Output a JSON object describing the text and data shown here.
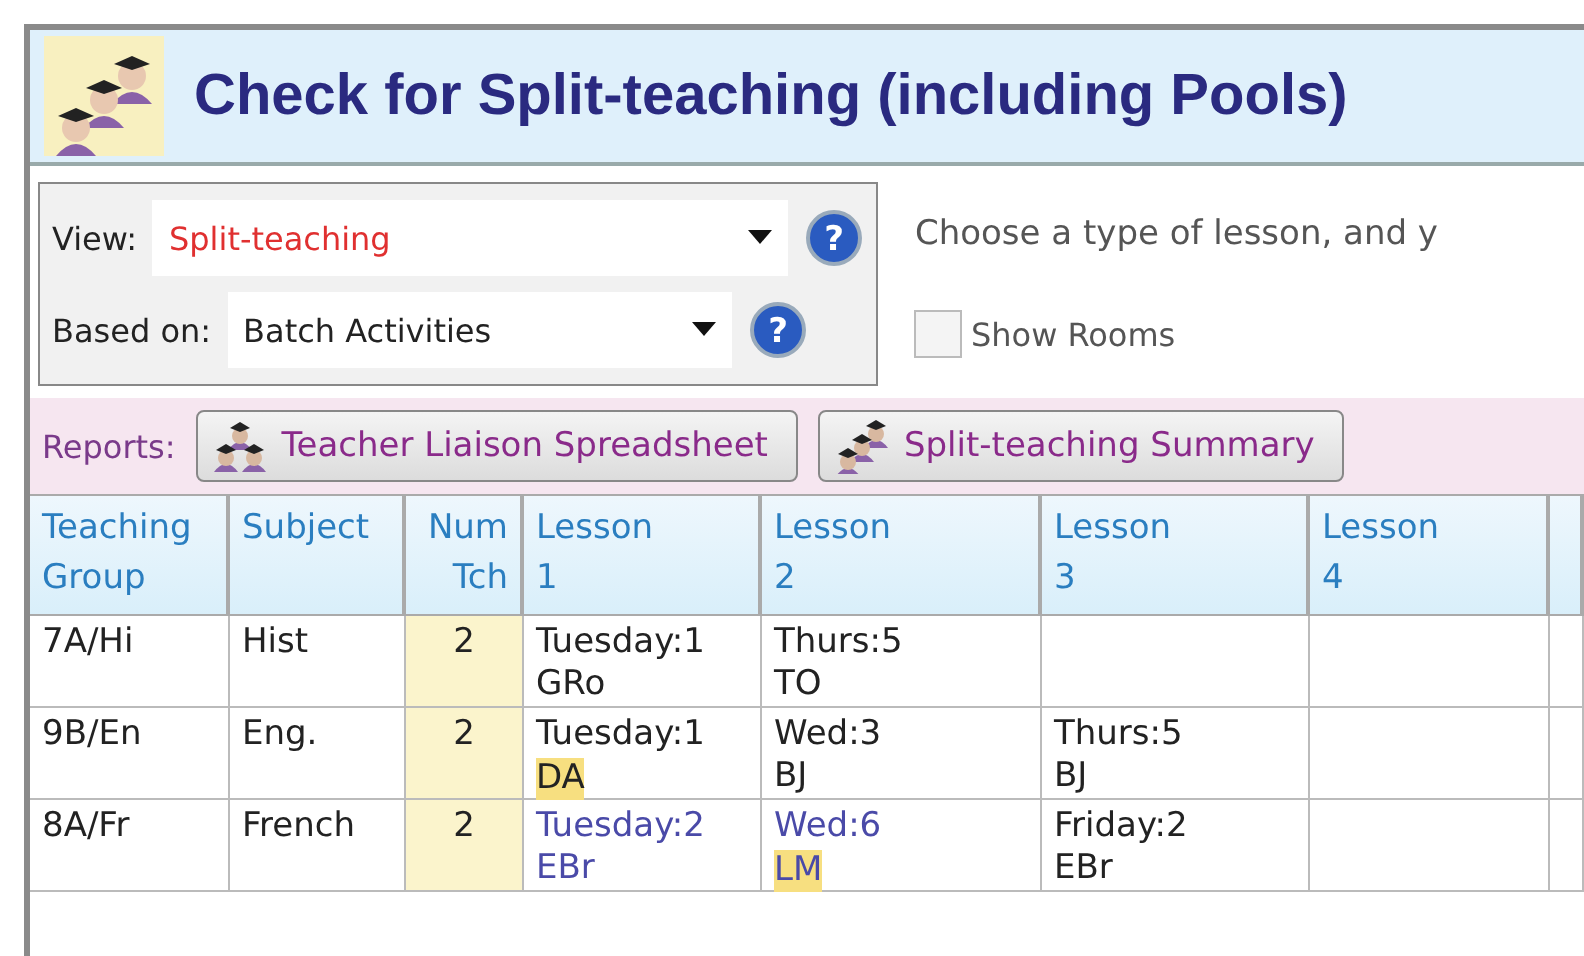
{
  "window": {
    "title": "Check for Split-teaching (including Pools)"
  },
  "fields": [
    {
      "label": "View:",
      "value": "Split-teaching",
      "kind": "alert",
      "help": "?"
    },
    {
      "label": "Based on:",
      "value": "Batch Activities",
      "kind": "normal",
      "help": "?"
    }
  ],
  "hint": "Choose a type of lesson, and y",
  "show_rooms": {
    "label": "Show Rooms",
    "checked": false
  },
  "reports": {
    "label": "Reports:",
    "buttons": [
      "Teacher Liaison Spreadsheet",
      "Split-teaching Summary"
    ]
  },
  "table": {
    "columns": [
      [
        "Teaching",
        "Group"
      ],
      [
        "Subject",
        ""
      ],
      [
        "Num",
        "Tch"
      ],
      [
        "Lesson",
        "1"
      ],
      [
        "Lesson",
        "2"
      ],
      [
        "Lesson",
        "3"
      ],
      [
        "Lesson",
        "4"
      ]
    ],
    "rows": [
      {
        "group": "7A/Hi",
        "subject": "Hist",
        "num": "2",
        "lessons": [
          {
            "time": "Tuesday:1",
            "teacher": "GRo",
            "moved": false,
            "highlighted": false
          },
          {
            "time": "Thurs:5",
            "teacher": "TO",
            "moved": false,
            "highlighted": false
          }
        ]
      },
      {
        "group": "9B/En",
        "subject": "Eng.",
        "num": "2",
        "lessons": [
          {
            "time": "Tuesday:1",
            "teacher": "DA",
            "moved": false,
            "highlighted": true
          },
          {
            "time": "Wed:3",
            "teacher": "BJ",
            "moved": false,
            "highlighted": false
          },
          {
            "time": "Thurs:5",
            "teacher": "BJ",
            "moved": false,
            "highlighted": false
          }
        ]
      },
      {
        "group": "8A/Fr",
        "subject": "French",
        "num": "2",
        "lessons": [
          {
            "time": "Tuesday:2",
            "teacher": "EBr",
            "moved": true,
            "highlighted": false
          },
          {
            "time": "Wed:6",
            "teacher": "LM",
            "moved": true,
            "highlighted": true
          },
          {
            "time": "Friday:2",
            "teacher": "EBr",
            "moved": false,
            "highlighted": false
          }
        ]
      }
    ]
  }
}
